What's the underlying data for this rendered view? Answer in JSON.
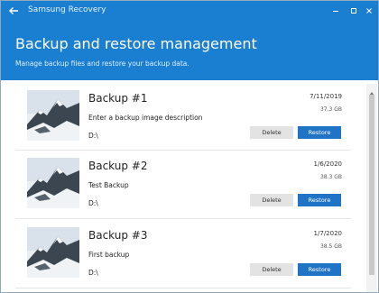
{
  "app": {
    "title": "Samsung Recovery"
  },
  "header": {
    "title": "Backup and restore management",
    "subtitle": "Manage backup files and restore your backup data."
  },
  "backups": [
    {
      "name": "Backup #1",
      "description": "Enter a backup image description",
      "drive": "D:\\",
      "date": "7/11/2019",
      "size": "37.3 GB",
      "delete_label": "Delete",
      "restore_label": "Restore"
    },
    {
      "name": "Backup #2",
      "description": "Test Backup",
      "drive": "D:\\",
      "date": "1/6/2020",
      "size": "38.3 GB",
      "delete_label": "Delete",
      "restore_label": "Restore"
    },
    {
      "name": "Backup #3",
      "description": "First backup",
      "drive": "D:\\",
      "date": "1/7/2020",
      "size": "38.5 GB",
      "delete_label": "Delete",
      "restore_label": "Restore"
    }
  ],
  "colors": {
    "accent": "#1b7fd1",
    "restore_button": "#1f74c6",
    "delete_button": "#e3e3e3"
  },
  "icons": {
    "back": "back-arrow-icon",
    "minimize": "minimize-icon",
    "maximize": "maximize-icon",
    "close": "close-icon",
    "thumbnail": "mountain-image-icon"
  }
}
